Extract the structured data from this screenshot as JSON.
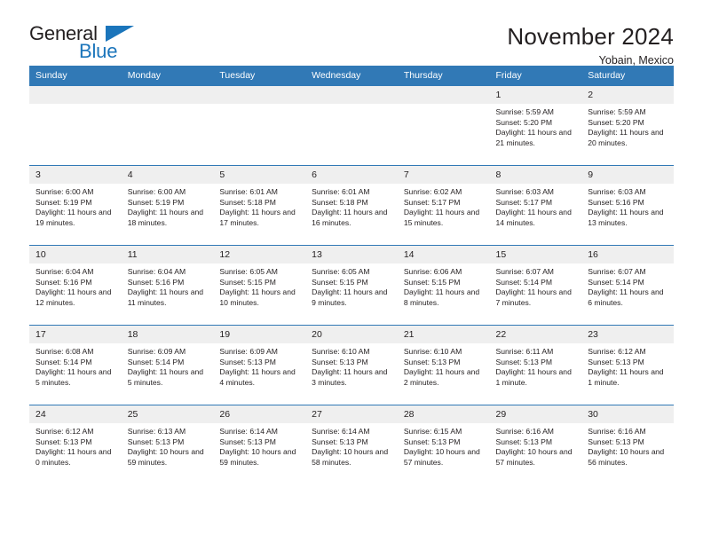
{
  "brand": {
    "name_part1": "General",
    "name_part2": "Blue",
    "triangle_icon": "triangle-icon",
    "accent_color": "#1b75bb"
  },
  "header": {
    "title": "November 2024",
    "subtitle": "Yobain, Mexico"
  },
  "theme": {
    "header_blue": "#3179b6",
    "daynum_band": "#efefef",
    "text": "#231f20"
  },
  "weekday_headers": [
    "Sunday",
    "Monday",
    "Tuesday",
    "Wednesday",
    "Thursday",
    "Friday",
    "Saturday"
  ],
  "labels": {
    "sunrise_prefix": "Sunrise:",
    "sunset_prefix": "Sunset:",
    "daylight_prefix": "Daylight:"
  },
  "weeks": [
    [
      {
        "day": "",
        "empty": true
      },
      {
        "day": "",
        "empty": true
      },
      {
        "day": "",
        "empty": true
      },
      {
        "day": "",
        "empty": true
      },
      {
        "day": "",
        "empty": true
      },
      {
        "day": "1",
        "sunrise": "Sunrise: 5:59 AM",
        "sunset": "Sunset: 5:20 PM",
        "daylight": "Daylight: 11 hours and 21 minutes."
      },
      {
        "day": "2",
        "sunrise": "Sunrise: 5:59 AM",
        "sunset": "Sunset: 5:20 PM",
        "daylight": "Daylight: 11 hours and 20 minutes."
      }
    ],
    [
      {
        "day": "3",
        "sunrise": "Sunrise: 6:00 AM",
        "sunset": "Sunset: 5:19 PM",
        "daylight": "Daylight: 11 hours and 19 minutes."
      },
      {
        "day": "4",
        "sunrise": "Sunrise: 6:00 AM",
        "sunset": "Sunset: 5:19 PM",
        "daylight": "Daylight: 11 hours and 18 minutes."
      },
      {
        "day": "5",
        "sunrise": "Sunrise: 6:01 AM",
        "sunset": "Sunset: 5:18 PM",
        "daylight": "Daylight: 11 hours and 17 minutes."
      },
      {
        "day": "6",
        "sunrise": "Sunrise: 6:01 AM",
        "sunset": "Sunset: 5:18 PM",
        "daylight": "Daylight: 11 hours and 16 minutes."
      },
      {
        "day": "7",
        "sunrise": "Sunrise: 6:02 AM",
        "sunset": "Sunset: 5:17 PM",
        "daylight": "Daylight: 11 hours and 15 minutes."
      },
      {
        "day": "8",
        "sunrise": "Sunrise: 6:03 AM",
        "sunset": "Sunset: 5:17 PM",
        "daylight": "Daylight: 11 hours and 14 minutes."
      },
      {
        "day": "9",
        "sunrise": "Sunrise: 6:03 AM",
        "sunset": "Sunset: 5:16 PM",
        "daylight": "Daylight: 11 hours and 13 minutes."
      }
    ],
    [
      {
        "day": "10",
        "sunrise": "Sunrise: 6:04 AM",
        "sunset": "Sunset: 5:16 PM",
        "daylight": "Daylight: 11 hours and 12 minutes."
      },
      {
        "day": "11",
        "sunrise": "Sunrise: 6:04 AM",
        "sunset": "Sunset: 5:16 PM",
        "daylight": "Daylight: 11 hours and 11 minutes."
      },
      {
        "day": "12",
        "sunrise": "Sunrise: 6:05 AM",
        "sunset": "Sunset: 5:15 PM",
        "daylight": "Daylight: 11 hours and 10 minutes."
      },
      {
        "day": "13",
        "sunrise": "Sunrise: 6:05 AM",
        "sunset": "Sunset: 5:15 PM",
        "daylight": "Daylight: 11 hours and 9 minutes."
      },
      {
        "day": "14",
        "sunrise": "Sunrise: 6:06 AM",
        "sunset": "Sunset: 5:15 PM",
        "daylight": "Daylight: 11 hours and 8 minutes."
      },
      {
        "day": "15",
        "sunrise": "Sunrise: 6:07 AM",
        "sunset": "Sunset: 5:14 PM",
        "daylight": "Daylight: 11 hours and 7 minutes."
      },
      {
        "day": "16",
        "sunrise": "Sunrise: 6:07 AM",
        "sunset": "Sunset: 5:14 PM",
        "daylight": "Daylight: 11 hours and 6 minutes."
      }
    ],
    [
      {
        "day": "17",
        "sunrise": "Sunrise: 6:08 AM",
        "sunset": "Sunset: 5:14 PM",
        "daylight": "Daylight: 11 hours and 5 minutes."
      },
      {
        "day": "18",
        "sunrise": "Sunrise: 6:09 AM",
        "sunset": "Sunset: 5:14 PM",
        "daylight": "Daylight: 11 hours and 5 minutes."
      },
      {
        "day": "19",
        "sunrise": "Sunrise: 6:09 AM",
        "sunset": "Sunset: 5:13 PM",
        "daylight": "Daylight: 11 hours and 4 minutes."
      },
      {
        "day": "20",
        "sunrise": "Sunrise: 6:10 AM",
        "sunset": "Sunset: 5:13 PM",
        "daylight": "Daylight: 11 hours and 3 minutes."
      },
      {
        "day": "21",
        "sunrise": "Sunrise: 6:10 AM",
        "sunset": "Sunset: 5:13 PM",
        "daylight": "Daylight: 11 hours and 2 minutes."
      },
      {
        "day": "22",
        "sunrise": "Sunrise: 6:11 AM",
        "sunset": "Sunset: 5:13 PM",
        "daylight": "Daylight: 11 hours and 1 minute."
      },
      {
        "day": "23",
        "sunrise": "Sunrise: 6:12 AM",
        "sunset": "Sunset: 5:13 PM",
        "daylight": "Daylight: 11 hours and 1 minute."
      }
    ],
    [
      {
        "day": "24",
        "sunrise": "Sunrise: 6:12 AM",
        "sunset": "Sunset: 5:13 PM",
        "daylight": "Daylight: 11 hours and 0 minutes."
      },
      {
        "day": "25",
        "sunrise": "Sunrise: 6:13 AM",
        "sunset": "Sunset: 5:13 PM",
        "daylight": "Daylight: 10 hours and 59 minutes."
      },
      {
        "day": "26",
        "sunrise": "Sunrise: 6:14 AM",
        "sunset": "Sunset: 5:13 PM",
        "daylight": "Daylight: 10 hours and 59 minutes."
      },
      {
        "day": "27",
        "sunrise": "Sunrise: 6:14 AM",
        "sunset": "Sunset: 5:13 PM",
        "daylight": "Daylight: 10 hours and 58 minutes."
      },
      {
        "day": "28",
        "sunrise": "Sunrise: 6:15 AM",
        "sunset": "Sunset: 5:13 PM",
        "daylight": "Daylight: 10 hours and 57 minutes."
      },
      {
        "day": "29",
        "sunrise": "Sunrise: 6:16 AM",
        "sunset": "Sunset: 5:13 PM",
        "daylight": "Daylight: 10 hours and 57 minutes."
      },
      {
        "day": "30",
        "sunrise": "Sunrise: 6:16 AM",
        "sunset": "Sunset: 5:13 PM",
        "daylight": "Daylight: 10 hours and 56 minutes."
      }
    ]
  ]
}
